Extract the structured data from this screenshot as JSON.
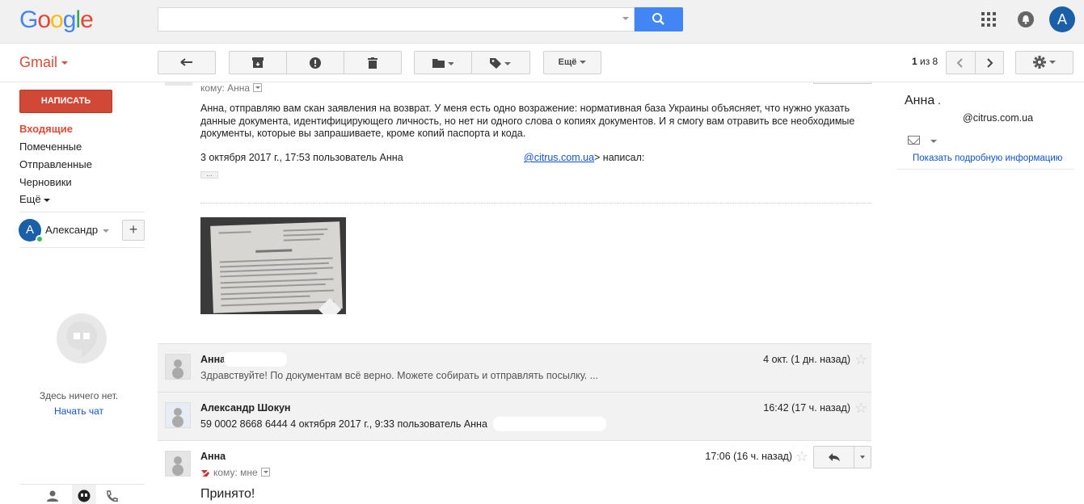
{
  "header": {
    "logo_letters": [
      {
        "ch": "G",
        "color": "#4285f4"
      },
      {
        "ch": "o",
        "color": "#ea4335"
      },
      {
        "ch": "o",
        "color": "#fbbc05"
      },
      {
        "ch": "g",
        "color": "#4285f4"
      },
      {
        "ch": "l",
        "color": "#34a853"
      },
      {
        "ch": "e",
        "color": "#ea4335"
      }
    ],
    "search_placeholder": "",
    "account_initial": "A"
  },
  "toolbar": {
    "app_name": "Gmail",
    "more_label": "Ещё",
    "pager_current": "1",
    "pager_text": " из 8"
  },
  "sidebar": {
    "compose_label": "НАПИСАТЬ",
    "items": [
      {
        "label": "Входящие",
        "active": true
      },
      {
        "label": "Помеченные"
      },
      {
        "label": "Отправленные"
      },
      {
        "label": "Черновики"
      },
      {
        "label": "Ещё"
      }
    ],
    "user_initial": "A",
    "user_name": "Александр",
    "chat_empty": "Здесь ничего нет.",
    "chat_start": "Начать чат"
  },
  "message": {
    "recipient_label": "кому: Анна",
    "body": "Анна, отправляю вам скан заявления на возврат. У меня есть одно возражение: нормативная база Украины объясняет, что нужно указать данные документа, идентифицирующего личность, но нет ни одного слова о копиях документов. И я смогу вам отравить все необходимые документы, которые вы запрашиваете, кроме копий паспорта и кода.",
    "quote_intro": "3 октября 2017 г., 17:53 пользователь Анна",
    "quote_email": "@citrus.com.ua",
    "quote_suffix": "> написал:",
    "ellipsis": "..."
  },
  "thread": [
    {
      "sender": "Анна",
      "snippet": "Здравствуйте! По документам всё верно. Можете собирать и отправлять посылку. ...",
      "date": "4 окт. (1 дн. назад)"
    },
    {
      "sender": "Александр Шокун",
      "snippet": "59 0002 8668 6444 4 октября 2017 г., 9:33 пользователь Анна",
      "date": "16:42 (17 ч. назад)"
    },
    {
      "sender": "Анна",
      "recipient": "кому: мне",
      "date": "17:06 (16 ч. назад)",
      "body": "Принято!"
    }
  ],
  "contact": {
    "name": "Анна",
    "email": "@citrus.com.ua",
    "details_link": "Показать подробную информацию"
  }
}
